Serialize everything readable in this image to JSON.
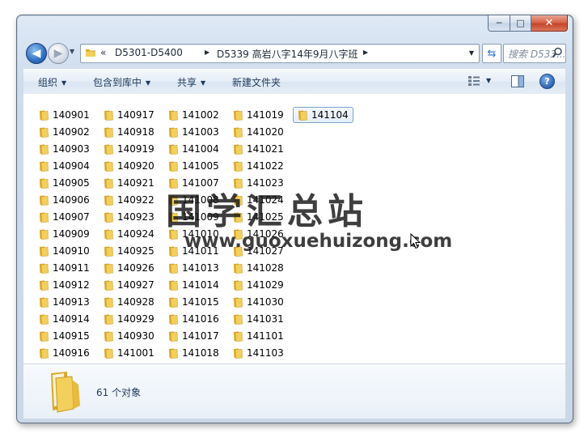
{
  "window": {
    "minimize_label": "─",
    "maximize_label": "□",
    "close_label": "✕"
  },
  "nav": {
    "back_glyph": "◀",
    "forward_glyph": "▶",
    "history_glyph": "▼",
    "breadcrumb_root": "«",
    "breadcrumbs": [
      "D5301-D5400",
      "D5339 高岩八字14年9月八字班"
    ],
    "crumb_arrow": "▶",
    "address_drop": "▼",
    "refresh_glyph": "⇆",
    "search_placeholder": "搜索 D533..."
  },
  "toolbar": {
    "organize": "组织",
    "include_library": "包含到库中",
    "share": "共享",
    "new_folder": "新建文件夹",
    "caret": "▼",
    "help": "?"
  },
  "files": {
    "columns": [
      [
        "140901",
        "140902",
        "140903",
        "140904",
        "140905",
        "140906",
        "140907",
        "140909",
        "140910",
        "140911",
        "140912",
        "140913",
        "140914",
        "140915",
        "140916"
      ],
      [
        "140917",
        "140918",
        "140919",
        "140920",
        "140921",
        "140922",
        "140923",
        "140924",
        "140925",
        "140926",
        "140927",
        "140928",
        "140929",
        "140930",
        "141001"
      ],
      [
        "141002",
        "141003",
        "141004",
        "141005",
        "141007",
        "141008",
        "141009",
        "141010",
        "141011",
        "141013",
        "141014",
        "141015",
        "141016",
        "141017",
        "141018"
      ],
      [
        "141019",
        "141020",
        "141021",
        "141022",
        "141023",
        "141024",
        "141025",
        "141026",
        "141027",
        "141028",
        "141029",
        "141030",
        "141031",
        "141101",
        "141103"
      ],
      [
        "141104"
      ]
    ],
    "selected": "141104"
  },
  "watermark": {
    "title": "国学汇总站",
    "url": "www.guoxuehuizong.com"
  },
  "details": {
    "count_text": "61 个对象"
  },
  "colors": {
    "folder_yellow": "#f3cf5b",
    "folder_dark": "#d9a92b",
    "accent": "#2f6fc0",
    "selection_border": "#7da2ce"
  }
}
